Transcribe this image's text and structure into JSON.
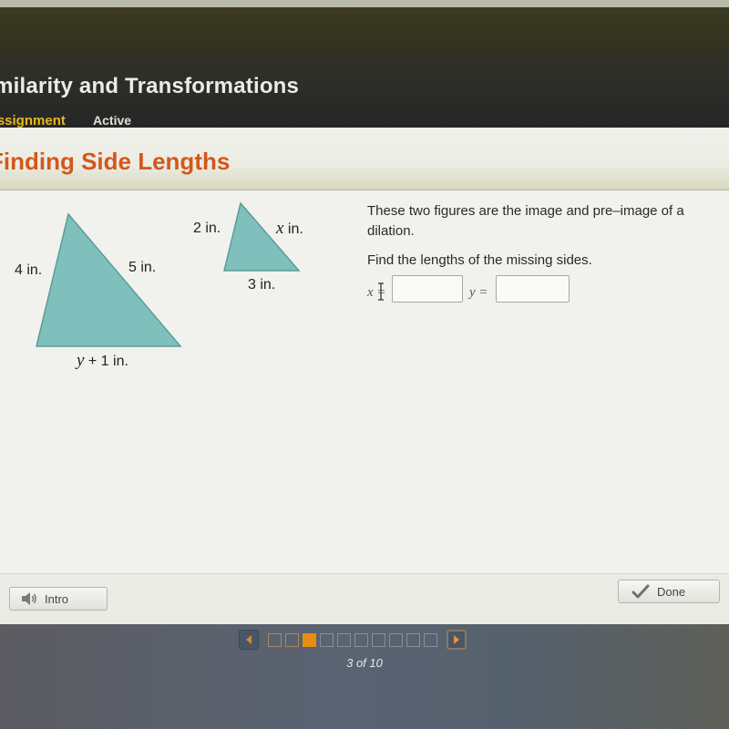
{
  "header": {
    "course_title": "Similarity and Transformations",
    "tabs": [
      {
        "label": "Assignment",
        "state": "selected"
      },
      {
        "label": "Active",
        "state": "status"
      }
    ]
  },
  "lesson": {
    "title": "Finding Side Lengths"
  },
  "figures": {
    "large_triangle": {
      "left_side": "4 in.",
      "right_side": "5 in.",
      "bottom_var": "y",
      "bottom_rest": " + 1 in."
    },
    "small_triangle": {
      "left_side": "2 in.",
      "right_var": "x",
      "right_rest": " in.",
      "bottom_side": "3 in."
    },
    "fill_color": "#7fc0bc"
  },
  "question": {
    "line1": "These two figures are the image and pre–image of a dilation.",
    "line2": "Find the lengths of the missing sides.",
    "x_label": "x =",
    "y_label": "y =",
    "x_value": "",
    "y_value": ""
  },
  "buttons": {
    "intro": "Intro",
    "done": "Done"
  },
  "pager": {
    "current": 3,
    "total": 10,
    "label": "3 of 10",
    "accent": "#e98d12"
  }
}
